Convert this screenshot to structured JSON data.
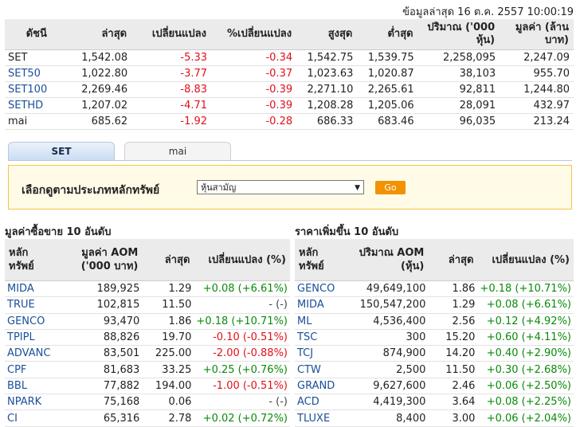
{
  "updated": "ข้อมูลล่าสุด 16 ต.ค. 2557 10:00:19",
  "index_table": {
    "headers": [
      "ดัชนี",
      "ล่าสุด",
      "เปลี่ยนแปลง",
      "%เปลี่ยนแปลง",
      "สูงสุด",
      "ต่ำสุด",
      "ปริมาณ ('000 หุ้น)",
      "มูลค่า (ล้านบาท)"
    ],
    "rows": [
      {
        "name": "SET",
        "last": "1,542.08",
        "chg": "-5.33",
        "pchg": "-0.34",
        "high": "1,542.75",
        "low": "1,539.75",
        "vol": "2,258,095",
        "val": "2,247.09"
      },
      {
        "name": "SET50",
        "last": "1,022.80",
        "chg": "-3.77",
        "pchg": "-0.37",
        "high": "1,023.63",
        "low": "1,020.87",
        "vol": "38,103",
        "val": "955.70"
      },
      {
        "name": "SET100",
        "last": "2,269.46",
        "chg": "-8.83",
        "pchg": "-0.39",
        "high": "2,271.10",
        "low": "2,265.61",
        "vol": "92,811",
        "val": "1,244.80"
      },
      {
        "name": "SETHD",
        "last": "1,207.02",
        "chg": "-4.71",
        "pchg": "-0.39",
        "high": "1,208.28",
        "low": "1,205.06",
        "vol": "28,091",
        "val": "432.97"
      },
      {
        "name": "mai",
        "last": "685.62",
        "chg": "-1.92",
        "pchg": "-0.28",
        "high": "686.33",
        "low": "683.46",
        "vol": "96,035",
        "val": "213.24"
      }
    ]
  },
  "tabs": {
    "active": "SET",
    "inactive": "mai"
  },
  "filter": {
    "label": "เลือกดูตามประเภทหลักทรัพย์",
    "selected": "หุ้นสามัญ",
    "go": "Go"
  },
  "top_value": {
    "title": "มูลค่าซื้อขาย 10 อันดับ",
    "headers": [
      "หลัก ทรัพย์",
      "มูลค่า AOM ('000 บาท)",
      "ล่าสุด",
      "เปลี่ยนแปลง (%)"
    ],
    "rows": [
      {
        "sym": "MIDA",
        "v": "189,925",
        "last": "1.29",
        "chg": "+0.08 (+6.61%)",
        "dir": "pos"
      },
      {
        "sym": "TRUE",
        "v": "102,815",
        "last": "11.50",
        "chg": "- (-)",
        "dir": "none"
      },
      {
        "sym": "GENCO",
        "v": "93,470",
        "last": "1.86",
        "chg": "+0.18 (+10.71%)",
        "dir": "pos"
      },
      {
        "sym": "TPIPL",
        "v": "88,826",
        "last": "19.70",
        "chg": "-0.10 (-0.51%)",
        "dir": "neg"
      },
      {
        "sym": "ADVANC",
        "v": "83,501",
        "last": "225.00",
        "chg": "-2.00 (-0.88%)",
        "dir": "neg"
      },
      {
        "sym": "CPF",
        "v": "81,683",
        "last": "33.25",
        "chg": "+0.25 (+0.76%)",
        "dir": "pos"
      },
      {
        "sym": "BBL",
        "v": "77,882",
        "last": "194.00",
        "chg": "-1.00 (-0.51%)",
        "dir": "neg"
      },
      {
        "sym": "NPARK",
        "v": "75,168",
        "last": "0.06",
        "chg": "- (-)",
        "dir": "none"
      },
      {
        "sym": "CI",
        "v": "65,316",
        "last": "2.78",
        "chg": "+0.02 (+0.72%)",
        "dir": "pos"
      }
    ]
  },
  "top_gain": {
    "title": "ราคาเพิ่มขึ้น 10 อันดับ",
    "headers": [
      "หลัก ทรัพย์",
      "ปริมาณ AOM (หุ้น)",
      "ล่าสุด",
      "เปลี่ยนแปลง (%)"
    ],
    "rows": [
      {
        "sym": "GENCO",
        "v": "49,649,100",
        "last": "1.86",
        "chg": "+0.18 (+10.71%)",
        "dir": "pos"
      },
      {
        "sym": "MIDA",
        "v": "150,547,200",
        "last": "1.29",
        "chg": "+0.08 (+6.61%)",
        "dir": "pos"
      },
      {
        "sym": "ML",
        "v": "4,536,400",
        "last": "2.56",
        "chg": "+0.12 (+4.92%)",
        "dir": "pos"
      },
      {
        "sym": "TSC",
        "v": "300",
        "last": "15.20",
        "chg": "+0.60 (+4.11%)",
        "dir": "pos"
      },
      {
        "sym": "TCJ",
        "v": "874,900",
        "last": "14.20",
        "chg": "+0.40 (+2.90%)",
        "dir": "pos"
      },
      {
        "sym": "CTW",
        "v": "2,500",
        "last": "11.50",
        "chg": "+0.30 (+2.68%)",
        "dir": "pos"
      },
      {
        "sym": "GRAND",
        "v": "9,627,600",
        "last": "2.46",
        "chg": "+0.06 (+2.50%)",
        "dir": "pos"
      },
      {
        "sym": "ACD",
        "v": "4,419,300",
        "last": "3.64",
        "chg": "+0.08 (+2.25%)",
        "dir": "pos"
      },
      {
        "sym": "TLUXE",
        "v": "8,400",
        "last": "3.00",
        "chg": "+0.06 (+2.04%)",
        "dir": "pos"
      }
    ]
  },
  "colors": {
    "neg": "#e0101a",
    "pos": "#0a8a0a",
    "link": "#1a4f9a",
    "accent": "#f29200"
  }
}
